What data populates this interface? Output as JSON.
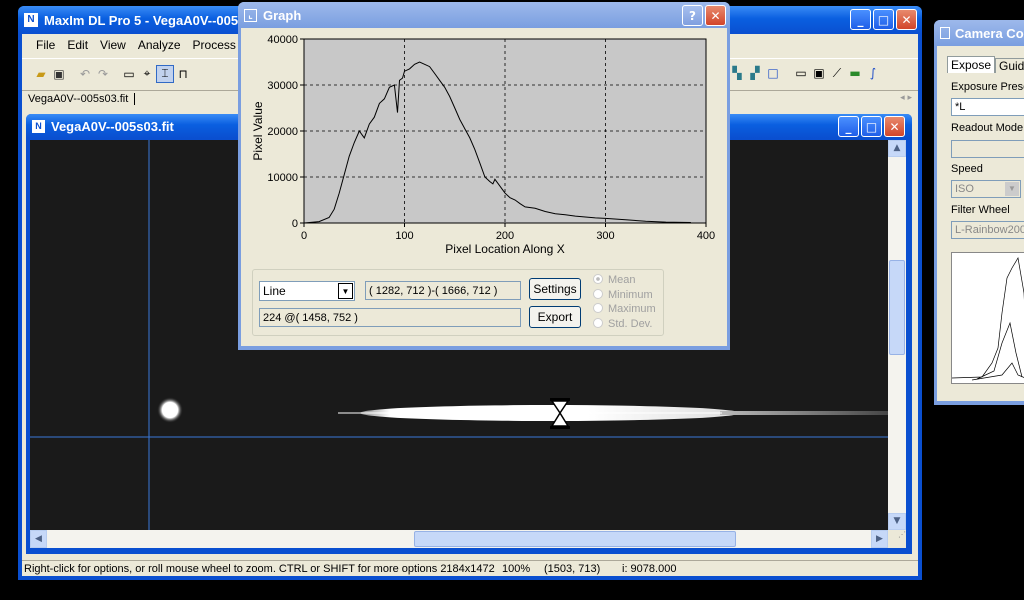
{
  "main_window": {
    "title": "MaxIm DL Pro 5 - VegaA0V--005",
    "menu": [
      "File",
      "Edit",
      "View",
      "Analyze",
      "Process"
    ],
    "doc_tab": "VegaA0V--005s03.fit",
    "status": {
      "hint": "Right-click for options, or roll mouse wheel to zoom. CTRL or SHIFT for more options 2184x1472",
      "zoom": "100%",
      "coords": "(1503, 713)",
      "intensity": "i:  9078.000"
    }
  },
  "image_window": {
    "title": "VegaA0V--005s03.fit"
  },
  "graph_window": {
    "title": "Graph",
    "mode_value": "Line",
    "range_value": "( 1282, 712 )-( 1666, 712 )",
    "readout_value": "224 @( 1458, 752 )",
    "settings_label": "Settings",
    "export_label": "Export",
    "radios": [
      "Mean",
      "Minimum",
      "Maximum",
      "Std. Dev."
    ]
  },
  "camera_window": {
    "title": "Camera Co",
    "tabs": [
      "Expose",
      "Guide"
    ],
    "exposure_preset_label": "Exposure Prese",
    "exposure_preset_value": "*L",
    "readout_mode_label": "Readout Mode",
    "speed_label": "Speed",
    "speed_value": "ISO",
    "filter_wheel_label": "Filter Wheel",
    "filter_wheel_value": "L-Rainbow200"
  },
  "chart_data": {
    "type": "line",
    "xlabel": "Pixel Location Along X",
    "ylabel": "Pixel Value",
    "xlim": [
      0,
      400
    ],
    "ylim": [
      0,
      40000
    ],
    "xticks": [
      "0",
      "100",
      "200",
      "300",
      "400"
    ],
    "yticks": [
      "0",
      "10000",
      "20000",
      "30000",
      "40000"
    ],
    "grid": true,
    "x": [
      0,
      15,
      25,
      30,
      35,
      40,
      45,
      50,
      55,
      60,
      65,
      70,
      75,
      80,
      85,
      90,
      93,
      95,
      98,
      100,
      105,
      110,
      115,
      120,
      125,
      130,
      135,
      140,
      145,
      150,
      155,
      160,
      165,
      170,
      175,
      180,
      185,
      188,
      190,
      195,
      200,
      205,
      210,
      215,
      220,
      230,
      240,
      250,
      260,
      270,
      280,
      290,
      300,
      320,
      340,
      360,
      385
    ],
    "y": [
      0,
      300,
      1200,
      3000,
      6500,
      10500,
      14500,
      17500,
      20000,
      18500,
      21500,
      23000,
      26000,
      27000,
      29500,
      30000,
      24000,
      31000,
      31500,
      33000,
      33500,
      34500,
      35000,
      34500,
      34000,
      32500,
      31000,
      29500,
      27500,
      25000,
      22500,
      20500,
      18500,
      16000,
      13000,
      10000,
      9000,
      8500,
      9500,
      8000,
      6500,
      5500,
      5000,
      4200,
      3500,
      3200,
      2500,
      2000,
      1800,
      1500,
      1300,
      1100,
      1000,
      700,
      400,
      200,
      100
    ]
  }
}
